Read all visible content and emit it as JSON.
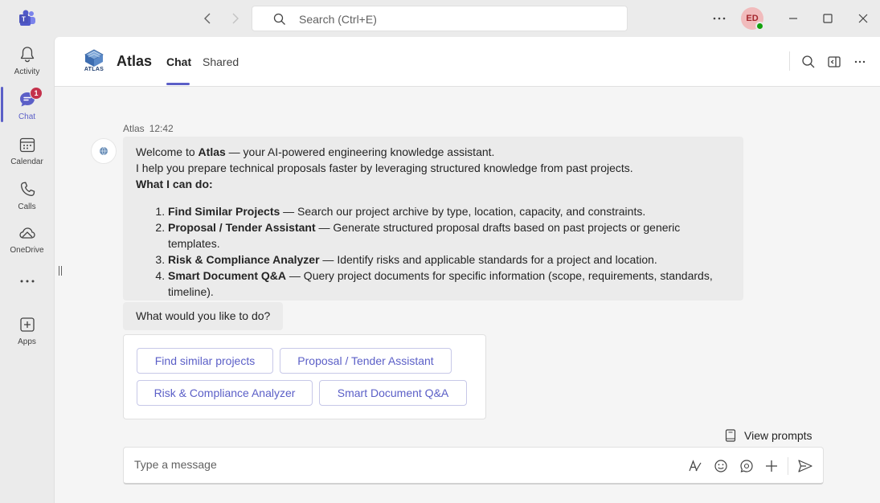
{
  "titlebar": {
    "search_placeholder": "Search (Ctrl+E)",
    "avatar_initials": "ED"
  },
  "rail": {
    "items": [
      {
        "label": "Activity",
        "icon": "bell-icon"
      },
      {
        "label": "Chat",
        "icon": "chat-icon",
        "badge": "1",
        "active": true
      },
      {
        "label": "Calendar",
        "icon": "calendar-icon"
      },
      {
        "label": "Calls",
        "icon": "phone-icon"
      },
      {
        "label": "OneDrive",
        "icon": "cloud-icon"
      },
      {
        "label": "Apps",
        "icon": "add-app-icon"
      }
    ]
  },
  "chat_header": {
    "bot_name": "Atlas",
    "logo_text": "ATLAS",
    "tabs": [
      {
        "label": "Chat",
        "active": true
      },
      {
        "label": "Shared",
        "active": false
      }
    ]
  },
  "conversation": {
    "sender": "Atlas",
    "time": "12:42",
    "intro": {
      "prefix": "Welcome to ",
      "bold": "Atlas",
      "suffix": " — your AI-powered engineering knowledge assistant."
    },
    "line2": "I help you prepare technical proposals faster by leveraging structured knowledge from past projects.",
    "what_heading": "What I can do:",
    "capabilities": [
      {
        "title": "Find Similar Projects",
        "desc": " — Search our project archive by type, location, capacity, and constraints."
      },
      {
        "title": "Proposal / Tender Assistant",
        "desc": " — Generate structured proposal drafts based on past projects or generic templates."
      },
      {
        "title": "Risk & Compliance Analyzer",
        "desc": " — Identify risks and applicable standards for a project and location."
      },
      {
        "title": "Smart Document Q&A",
        "desc": " — Query project documents for specific information (scope, requirements, standards, timeline)."
      }
    ],
    "followup": "What would you like to do?",
    "actions": [
      "Find similar projects",
      "Proposal / Tender Assistant",
      "Risk & Compliance Analyzer",
      "Smart Document Q&A"
    ]
  },
  "composer": {
    "view_prompts": "View prompts",
    "placeholder": "Type a message"
  },
  "colors": {
    "accent": "#5b5fc7",
    "badge": "#c4314b",
    "presence": "#13a10e"
  }
}
